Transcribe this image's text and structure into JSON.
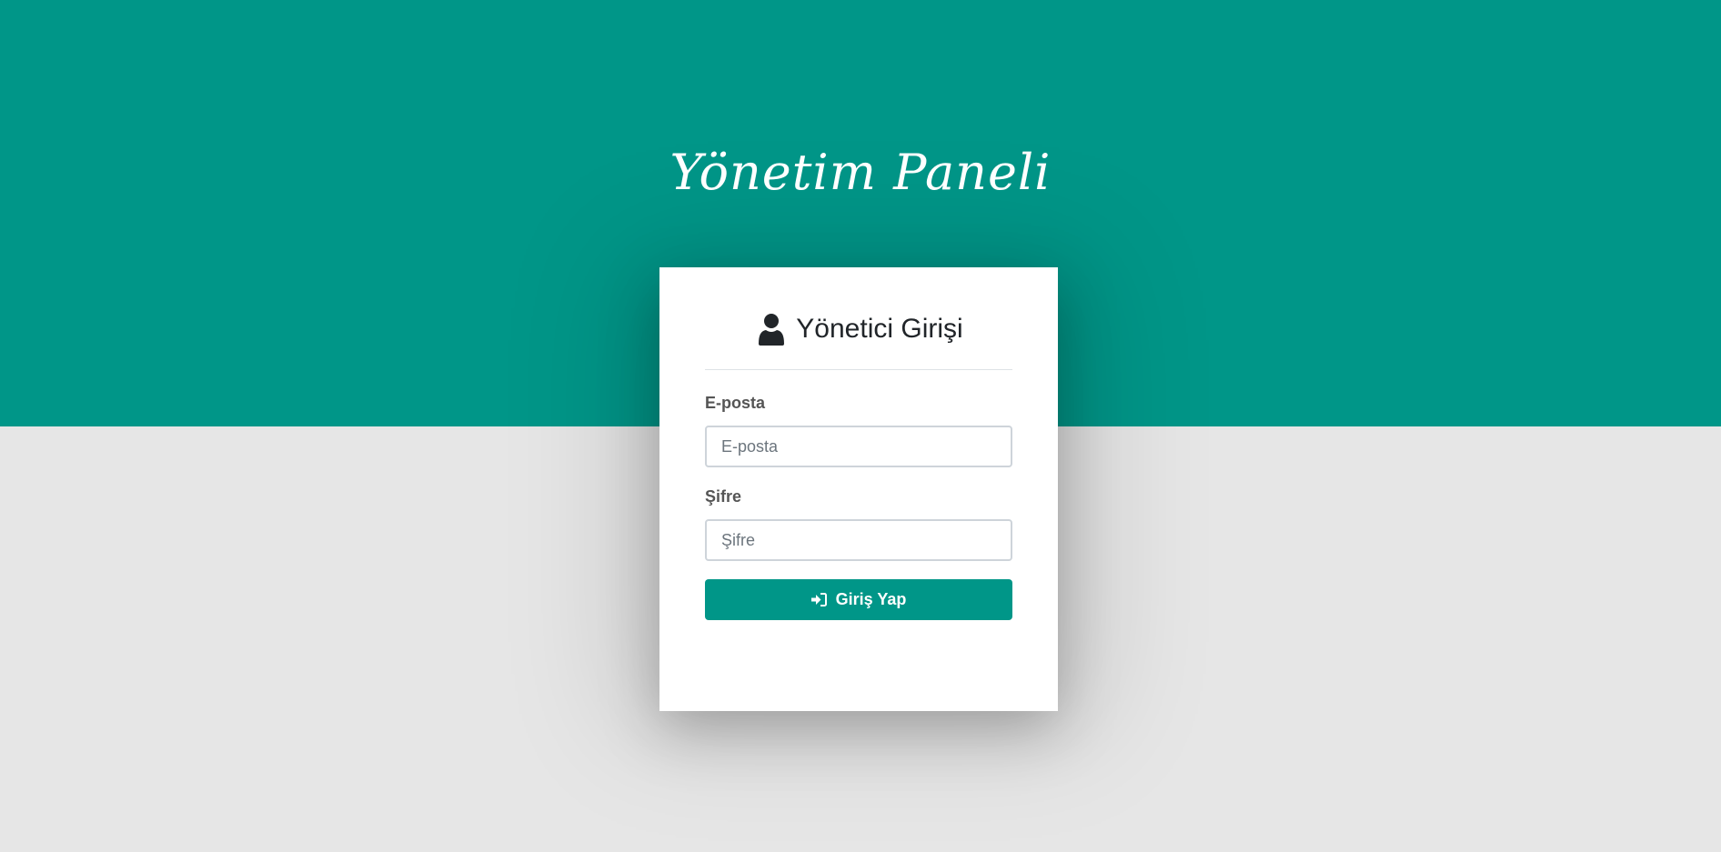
{
  "theme": {
    "accent": "#009688",
    "background": "#e6e6e6"
  },
  "brand": {
    "title": "Yönetim Paneli"
  },
  "login": {
    "heading": "Yönetici Girişi",
    "heading_icon": "user-icon",
    "email": {
      "label": "E-posta",
      "placeholder": "E-posta",
      "value": ""
    },
    "password": {
      "label": "Şifre",
      "placeholder": "Şifre",
      "value": ""
    },
    "submit": {
      "label": "Giriş Yap",
      "icon": "sign-in-icon"
    }
  }
}
